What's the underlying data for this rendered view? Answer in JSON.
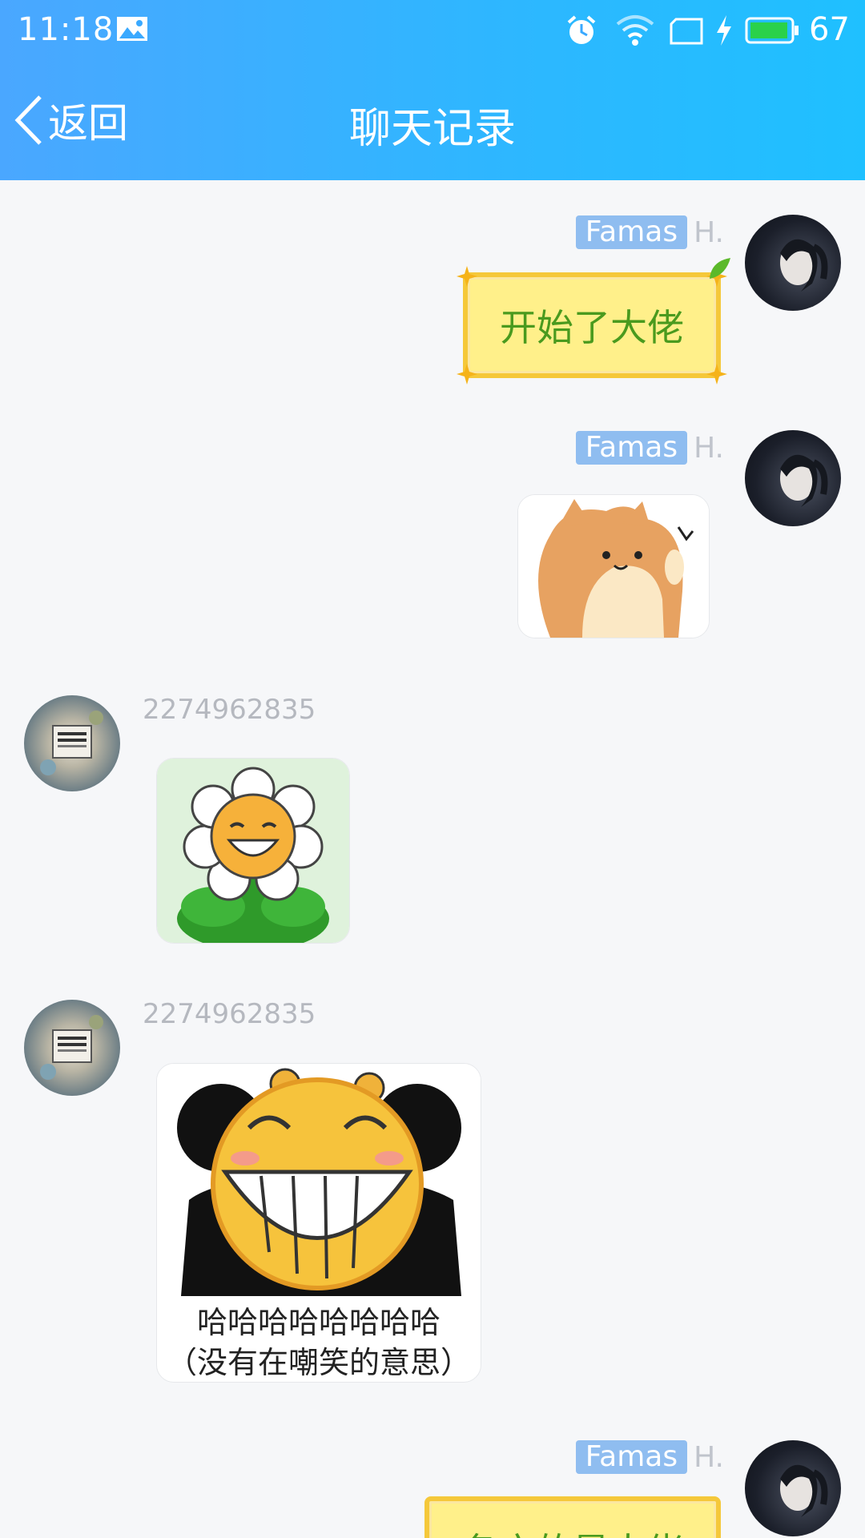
{
  "status_bar": {
    "time": "11:18",
    "battery": "67"
  },
  "nav": {
    "back_label": "返回",
    "title": "聊天记录"
  },
  "messages": [
    {
      "sender_tag": "Famas",
      "sender_suffix": "H.",
      "text": "开始了大佬"
    },
    {
      "sender_tag": "Famas",
      "sender_suffix": "H.",
      "sticker": "shiba-dog-sticker"
    },
    {
      "uid": "2274962835",
      "sticker": "smiling-flower-sticker"
    },
    {
      "uid": "2274962835",
      "sticker": "laughing-panda-sticker",
      "caption_line1": "哈哈哈哈哈哈哈哈",
      "caption_line2": "（没有在嘲笑的意思）"
    },
    {
      "sender_tag": "Famas",
      "sender_suffix": "H.",
      "text": "各方的是大佬"
    }
  ],
  "colors": {
    "header_start": "#4aa7ff",
    "header_end": "#1fc0ff",
    "bubble_fill": "#fff08a",
    "bubble_text": "#4a9a1e",
    "name_tag": "#8fbdf0"
  }
}
